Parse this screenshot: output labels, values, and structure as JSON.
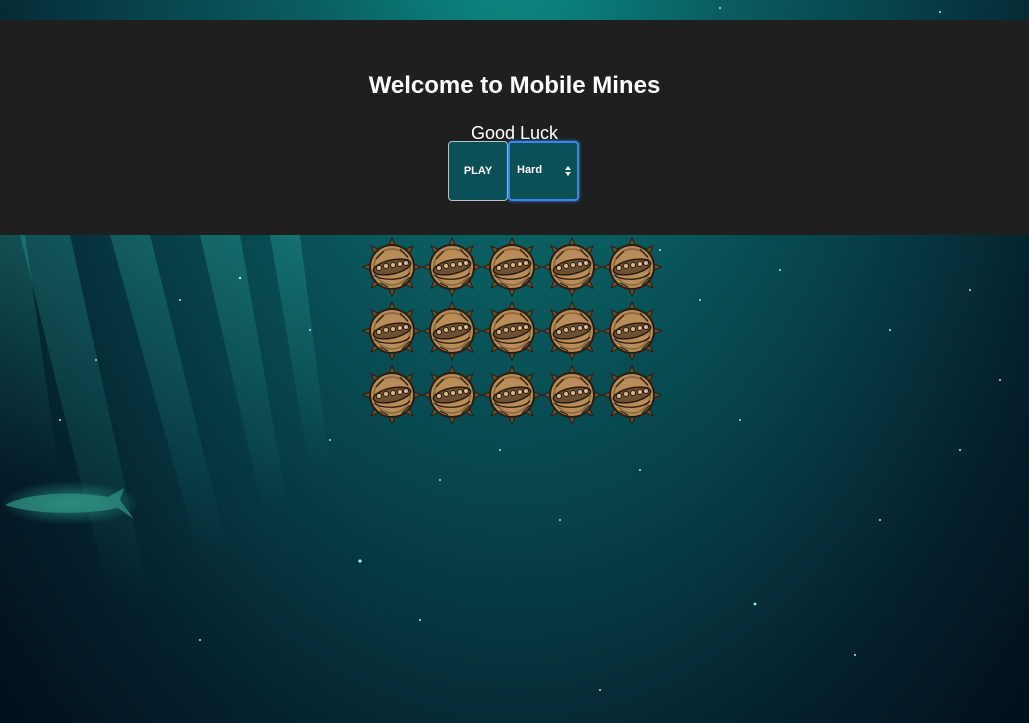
{
  "header": {
    "title": "Welcome to Mobile Mines",
    "subtitle": "Good Luck"
  },
  "controls": {
    "play_label": "PLAY",
    "difficulty_selected": "Hard"
  },
  "board": {
    "rows": 3,
    "cols": 5,
    "cell_icon": "sea-mine-icon"
  },
  "colors": {
    "header_bg": "#1f1f1f",
    "button_bg": "#0b4f57",
    "focus_ring": "#3b86e8",
    "mine_body": "#b88d5a"
  }
}
